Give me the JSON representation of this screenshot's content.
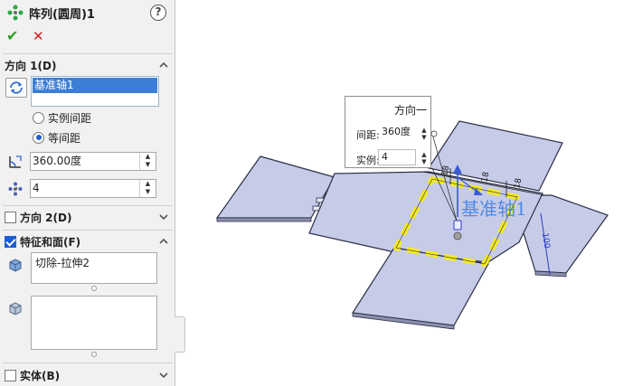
{
  "title": "阵列(圆周)1",
  "help_label": "?",
  "actions": {
    "ok": "✔",
    "cancel": "✕"
  },
  "direction1": {
    "header": "方向 1(D)",
    "axis_value": "基准轴1",
    "radio_spacing": "实例间距",
    "radio_equal": "等间距",
    "selected_radio": "equal",
    "angle_value": "360.00度",
    "count_value": "4"
  },
  "direction2": {
    "header": "方向 2(D)",
    "checked": false
  },
  "features": {
    "header": "特征和面(F)",
    "checked": true,
    "feature_items": [
      "切除-拉伸2"
    ],
    "face_items": []
  },
  "bodies": {
    "header": "实体(B)",
    "checked": false
  },
  "popup": {
    "title": "方向一",
    "spacing_label": "间距:",
    "spacing_value": "360度",
    "count_label": "实例:",
    "count_value": "4"
  },
  "viewport": {
    "axis_label": "基准轴1",
    "dim_labels": [
      "18",
      "18",
      "18",
      "100"
    ]
  },
  "colors": {
    "plate_fill": "#c6cbe8",
    "plate_edge": "#2b2f45",
    "highlight": "#f4ea1e",
    "accent": "#1c5fd0",
    "axis_blue": "#3a5ad8"
  }
}
